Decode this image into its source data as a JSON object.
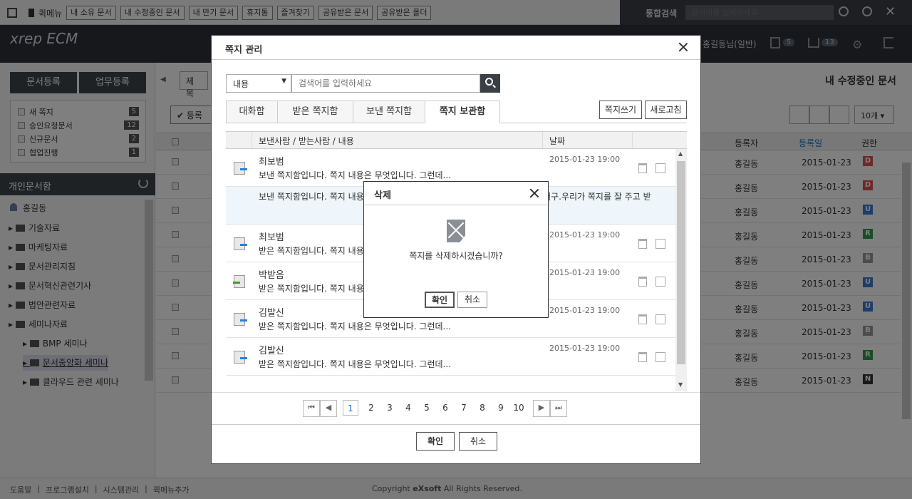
{
  "topbar": {
    "quickmenu_label": "퀵메뉴",
    "quick_buttons": [
      "내 소유 문서",
      "내 수정중인 문서",
      "내 만기 문서",
      "휴지통",
      "즐겨찾기",
      "공유받은 문서",
      "공유받은 폴더"
    ],
    "search_label": "통합검색",
    "search_placeholder": "검색어를 입력하세요"
  },
  "header": {
    "logo": "xrep ECM",
    "user": "홍길동님(일반)",
    "badge_approval": "5",
    "badge_cart": "13"
  },
  "sidebar": {
    "btn_doc_register": "문서등록",
    "btn_task_register": "업무등록",
    "notes": [
      {
        "label": "새 쪽지",
        "count": "5"
      },
      {
        "label": "승인요청문서",
        "count": "12"
      },
      {
        "label": "신규문서",
        "count": "2"
      },
      {
        "label": "협업진행",
        "count": "1"
      }
    ],
    "section_title": "개인문서함",
    "user": "홍길동",
    "folders": [
      "기술자료",
      "마케팅자료",
      "문서관리지침",
      "문서혁신관련기사",
      "법안관련자료",
      "세미나자료"
    ],
    "subfolders": [
      "BMP 세미나",
      "문서중앙화 세미나",
      "클라우드 관련 세미나"
    ]
  },
  "main": {
    "title": "내 수정중인 문서",
    "search_select": "제목",
    "register_btn": "등록",
    "page_size": "10개",
    "col_registrant": "등록자",
    "col_reg_date": "등록일",
    "col_permission": "권한",
    "rows": [
      {
        "user": "홍길동",
        "date": "2015-01-23",
        "perm": "D",
        "color": "#d9534f"
      },
      {
        "user": "홍길동",
        "date": "2015-01-23",
        "perm": "D",
        "color": "#d9534f"
      },
      {
        "user": "홍길동",
        "date": "2015-01-23",
        "perm": "U",
        "color": "#3a7bd5"
      },
      {
        "user": "홍길동",
        "date": "2015-01-23",
        "perm": "R",
        "color": "#2e9d4b"
      },
      {
        "user": "홍길동",
        "date": "2015-01-23",
        "perm": "B",
        "color": "#999999"
      },
      {
        "user": "홍길동",
        "date": "2015-01-23",
        "perm": "U",
        "color": "#3a7bd5"
      },
      {
        "user": "홍길동",
        "date": "2015-01-23",
        "perm": "U",
        "color": "#3a7bd5"
      },
      {
        "user": "홍길동",
        "date": "2015-01-23",
        "perm": "B",
        "color": "#999999"
      },
      {
        "user": "홍길동",
        "date": "2015-01-23",
        "perm": "R",
        "color": "#2e9d4b"
      },
      {
        "user": "홍길동",
        "date": "2015-01-23",
        "perm": "N",
        "color": "#333333"
      }
    ]
  },
  "footer": {
    "links": [
      "도움말",
      "프로그램설치",
      "시스템관리",
      "퀵메뉴추가"
    ],
    "copyright_prefix": "Copyright ",
    "copyright_brand": "eXsoft",
    "copyright_suffix": " All Rights Reserved."
  },
  "modal": {
    "title": "쪽지 관리",
    "search_select": "내용",
    "search_placeholder": "검색어를 입력하세요",
    "tabs": [
      "대화함",
      "받은 쪽지함",
      "보낸 쪽지함",
      "쪽지 보관함"
    ],
    "write_btn": "쪽지쓰기",
    "refresh_btn": "새로고침",
    "col_main": "보낸사람 / 받는사람 / 내용",
    "col_date": "날짜",
    "rows": [
      {
        "sender": "최보범",
        "message": "보낸 쪽지함입니다. 쪽지 내용은 무엇입니다. 그런데...",
        "date": "2015-01-23 19:00",
        "icon": "outgoing"
      },
      {
        "sender": "",
        "message": "보낸 쪽지함입니다. 쪽지 내용은 무엇입니다. 그런데 받은 쪽지 내용은 어쩌구 저쩌구.우리가 쪽지를 잘 주고 받",
        "date": "",
        "icon": "",
        "expanded": true
      },
      {
        "sender": "최보범",
        "message": "받은 쪽지함입니다. 쪽지 내용은 무엇입니다. 그런데...",
        "date": "2015-01-23 19:00",
        "icon": "outgoing"
      },
      {
        "sender": "박받음",
        "message": "받은 쪽지함입니다. 쪽지 내용은 무엇입니다. 그런데...",
        "date": "2015-01-23 19:00",
        "icon": "incoming"
      },
      {
        "sender": "김발신",
        "message": "받은 쪽지함입니다. 쪽지 내용은 무엇입니다. 그런데...",
        "date": "2015-01-23 19:00",
        "icon": "outgoing"
      },
      {
        "sender": "김발신",
        "message": "받은 쪽지함입니다. 쪽지 내용은 무엇입니다. 그런데...",
        "date": "2015-01-23 19:00",
        "icon": "outgoing"
      }
    ],
    "pages": [
      "1",
      "2",
      "3",
      "4",
      "5",
      "6",
      "7",
      "8",
      "9",
      "10"
    ],
    "current_page": "1",
    "confirm_btn": "확인",
    "cancel_btn": "취소"
  },
  "dialog": {
    "title": "삭제",
    "message": "쪽지를 삭제하시겠습니까?",
    "confirm_btn": "확인",
    "cancel_btn": "취소"
  }
}
